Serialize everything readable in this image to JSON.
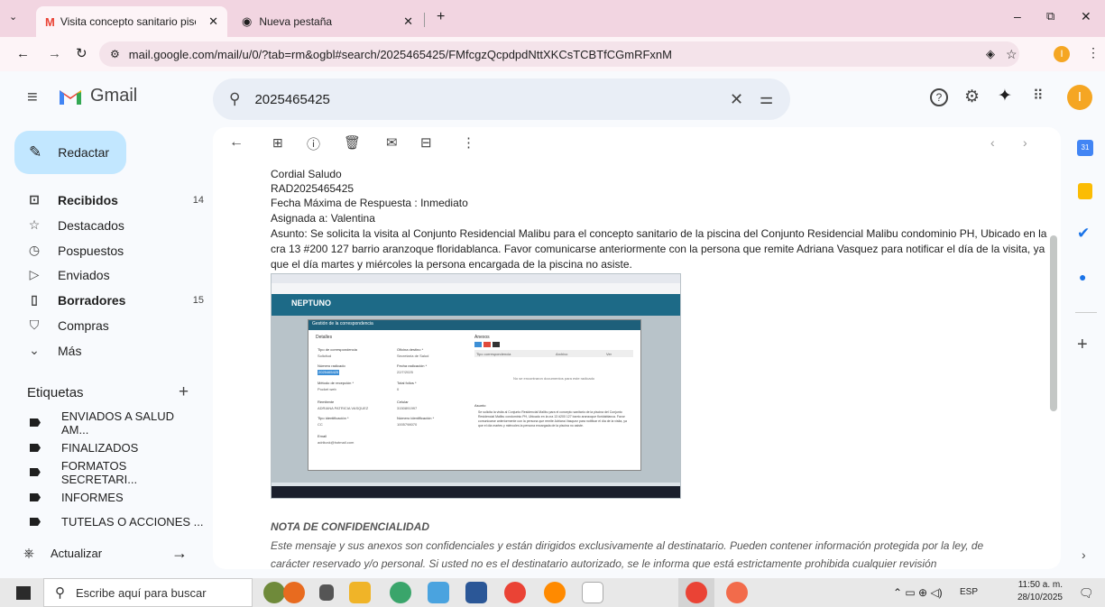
{
  "browser": {
    "tabs": [
      {
        "title": "Visita concepto sanitario piscina",
        "close": "✕"
      },
      {
        "title": "Nueva pestaña",
        "close": "✕"
      }
    ],
    "new_tab": "+",
    "url": "mail.google.com/mail/u/0/?tab=rm&ogbl#search/2025465425/FMfcgzQcpdpdNttXKCsTCBTfCGmRFxnM",
    "profile_initial": "I"
  },
  "gmail": {
    "brand": "Gmail",
    "search_value": "2025465425",
    "compose_label": "Redactar",
    "nav": [
      {
        "label": "Recibidos",
        "count": "14",
        "icon": "inbox-icon",
        "bold": true
      },
      {
        "label": "Destacados",
        "count": "",
        "icon": "star-icon"
      },
      {
        "label": "Pospuestos",
        "count": "",
        "icon": "clock-icon"
      },
      {
        "label": "Enviados",
        "count": "",
        "icon": "send-icon"
      },
      {
        "label": "Borradores",
        "count": "15",
        "icon": "draft-icon",
        "bold": true
      },
      {
        "label": "Compras",
        "count": "",
        "icon": "bag-icon"
      },
      {
        "label": "Más",
        "count": "",
        "icon": "chevron-down-icon"
      }
    ],
    "labels_title": "Etiquetas",
    "labels_add": "+",
    "labels": [
      "ENVIADOS A SALUD AM...",
      "FINALIZADOS",
      "FORMATOS SECRETARI...",
      "INFORMES",
      "TUTELAS O ACCIONES ..."
    ],
    "update_label": "Actualizar",
    "accent": "#0b57d0"
  },
  "email": {
    "lines": [
      "Cordial Saludo",
      "RAD2025465425",
      "Fecha Máxima de Respuesta : Inmediato",
      "Asignada a: Valentina",
      "Asunto: Se solicita la visita al Conjunto Residencial Malibu para el concepto sanitario de la piscina del Conjunto Residencial Malibu condominio PH, Ubicado en la",
      "cra 13 #200 127 barrio aranzoque floridablanca. Favor comunicarse anteriormente con la persona que remite Adriana Vasquez para notificar el día de la visita, ya",
      "que el día martes y miércoles la persona encargada de la piscina no asiste."
    ],
    "notice_title": "NOTA DE CONFIDENCIALIDAD",
    "notice_line1": "Este mensaje y sus anexos son confidenciales y están dirigidos exclusivamente al destinatario. Pueden contener información protegida por la ley, de",
    "notice_line2": "carácter reservado y/o personal. Si usted no es el destinatario autorizado, se le informa que está estrictamente prohibida cualquier revisión"
  },
  "embedded_screenshot": {
    "app_name": "NEPTUNO",
    "dialog_title": "Gestión de la correspondencia",
    "section_left": "Detalles",
    "section_right": "Anexos",
    "fields": [
      {
        "label": "Tipo de correspondencia",
        "value": "Solicitud"
      },
      {
        "label": "Oficina destino *",
        "value": "Secretaría de Salud"
      },
      {
        "label": "Número radicado",
        "value": "2025465425"
      },
      {
        "label": "Fecha radicación *",
        "value": "22/7/2025"
      },
      {
        "label": "Método de recepción *",
        "value": "Pocket web"
      },
      {
        "label": "Total folios *",
        "value": "0"
      },
      {
        "label": "Remitente",
        "value": "ADRIANA PATRICIA VASQUEZ"
      },
      {
        "label": "Celular",
        "value": "3150891997"
      },
      {
        "label": "Tipo identificación *",
        "value": "CC"
      },
      {
        "label": "Número identificación *",
        "value": "1005798070"
      },
      {
        "label": "Email",
        "value": "adrikvck@hotmail.com"
      }
    ],
    "annex_cols": [
      "Tipo correspondencia",
      "Archivo",
      "Ver"
    ],
    "annex_empty": "No se encontraron documentos para este radicado",
    "subject_label": "Asunto",
    "subject_text": "Se solicita la visita al Conjunto Residencial Malibu para el concepto sanitario de la piscina del Conjunto Residencial Malibu condominio PH, Ubicado en la cra 13 #200 127 barrio aranzoque floridablanca. Favor comunicarse anteriormente con la persona que remite Adriana Vasquez para notificar el día de la visita, ya que el día martes y miércoles la persona encargada de la piscina no asiste."
  },
  "taskbar": {
    "search_placeholder": "Escribe aquí para buscar",
    "lang": "ESP",
    "time": "11:50 a. m.",
    "date": "28/10/2025"
  }
}
